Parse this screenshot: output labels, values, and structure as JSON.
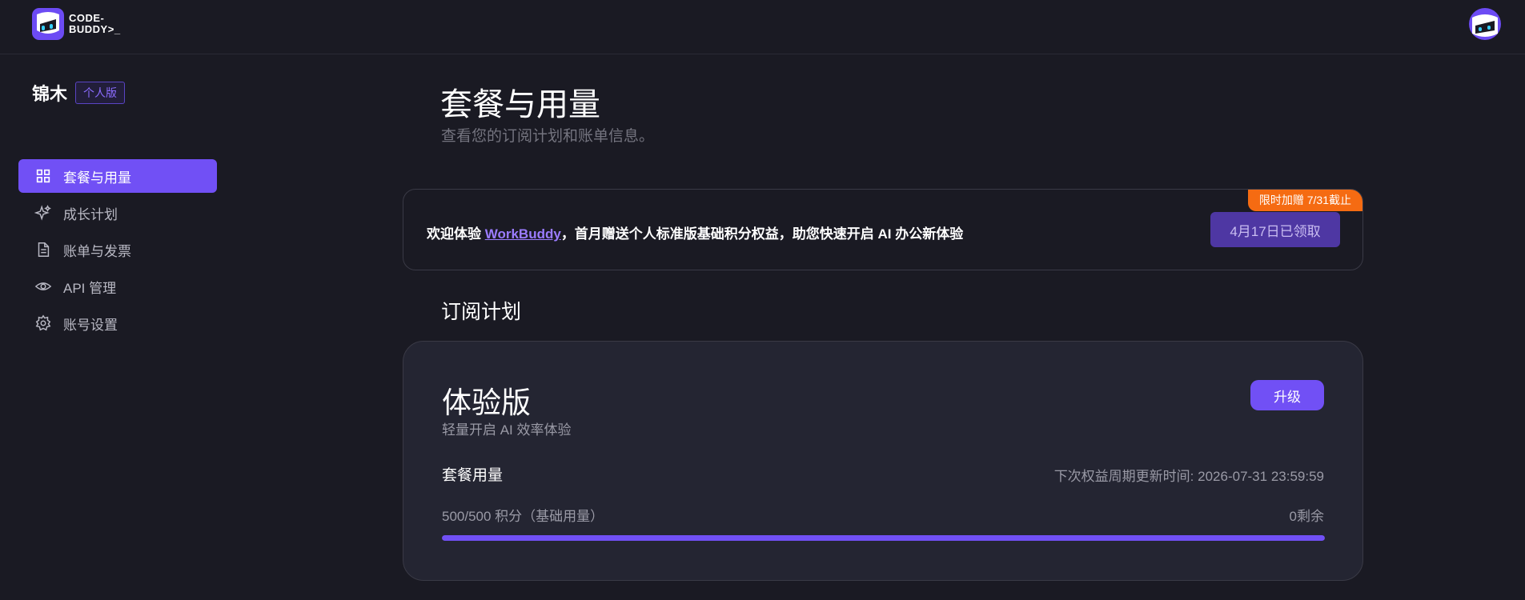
{
  "brand": {
    "logo_text": "CODE-\nBUDDY>_",
    "accent": "#7150f5"
  },
  "user": {
    "name": "锦木",
    "badge": "个人版"
  },
  "nav": {
    "items": [
      {
        "label": "套餐与用量",
        "icon": "grid-icon",
        "active": true
      },
      {
        "label": "成长计划",
        "icon": "sparkle-icon",
        "active": false
      },
      {
        "label": "账单与发票",
        "icon": "document-icon",
        "active": false
      },
      {
        "label": "API 管理",
        "icon": "eye-icon",
        "active": false
      },
      {
        "label": "账号设置",
        "icon": "gear-icon",
        "active": false
      }
    ]
  },
  "page": {
    "title": "套餐与用量",
    "subtitle": "查看您的订阅计划和账单信息。"
  },
  "promo": {
    "prefix": "欢迎体验 ",
    "link": "WorkBuddy",
    "suffix": "，首月赠送个人标准版基础积分权益，助您快速开启 AI 办公新体验",
    "ribbon": "限时加赠 7/31截止",
    "button": "4月17日已领取",
    "ribbon_color": "#f56b12"
  },
  "subscription": {
    "section_title": "订阅计划",
    "plan_name": "体验版",
    "plan_desc": "轻量开启 AI 效率体验",
    "upgrade": "升级",
    "usage_label": "套餐用量",
    "renew_text": "下次权益周期更新时间: 2026-07-31 23:59:59",
    "usage_count": "500/500 积分（基础用量）",
    "remaining": "0剩余",
    "progress": 1.0
  }
}
